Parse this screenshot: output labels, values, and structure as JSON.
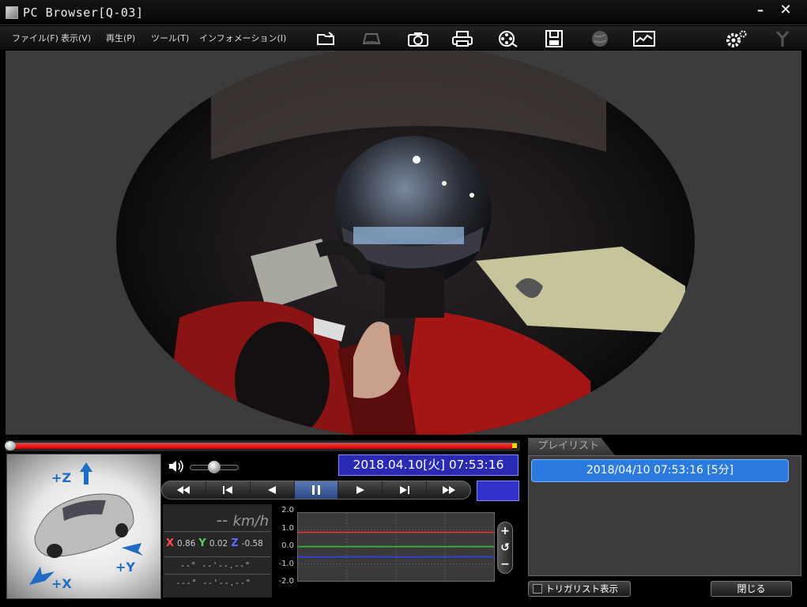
{
  "window": {
    "title": "PC Browser[Q-03]",
    "minimize_label": "–",
    "close_label": "✕"
  },
  "menu": {
    "items": [
      "ファイル(F)",
      "表示(V)",
      "再生(P)",
      "ツール(T)",
      "インフォメーション(I)"
    ]
  },
  "toolbar": {
    "icons": [
      "folder-export-icon",
      "disc-tray-icon",
      "camera-icon",
      "printer-icon",
      "film-search-icon",
      "save-icon",
      "globe-icon",
      "map-chart-icon",
      "settings-gears-icon",
      "antenna-icon"
    ]
  },
  "player": {
    "progress_fraction": 0.99,
    "volume_fraction": 0.5,
    "datetime": "2018.04.10[火] 07:53:16",
    "transport": [
      "rewind",
      "previous",
      "step-back",
      "pause",
      "play",
      "next",
      "fast-forward"
    ],
    "active_transport": "pause"
  },
  "car_view": {
    "axis_z": "+Z",
    "axis_y": "+Y",
    "axis_x": "+X"
  },
  "speed": {
    "value": "-- ",
    "unit": "km/h"
  },
  "gsensor": {
    "x_label": "X",
    "x_value": "0.86",
    "y_label": "Y",
    "y_value": "0.02",
    "z_label": "Z",
    "z_value": "-0.58"
  },
  "coordinates": {
    "lat": "--° --'--.--\"",
    "lon": "---° --'--.--\""
  },
  "graph": {
    "y_ticks": [
      "2.0",
      "1.0",
      "0.0",
      "-1.0",
      "-2.0"
    ],
    "zoom_in": "+",
    "zoom_reset": "↺",
    "zoom_out": "−"
  },
  "chart_data": {
    "type": "line",
    "ylim": [
      -2.0,
      2.0
    ],
    "series": [
      {
        "name": "X",
        "color": "#ff3030",
        "values": [
          0.86,
          0.86,
          0.86,
          0.86,
          0.86,
          0.86,
          0.86,
          0.86,
          0.86,
          0.86
        ]
      },
      {
        "name": "Y",
        "color": "#30c030",
        "values": [
          0.02,
          0.02,
          0.02,
          0.02,
          0.02,
          0.02,
          0.02,
          0.02,
          0.02,
          0.02
        ]
      },
      {
        "name": "Z",
        "color": "#3040ff",
        "values": [
          -0.58,
          -0.59,
          -0.58,
          -0.57,
          -0.58,
          -0.59,
          -0.58,
          -0.58,
          -0.57,
          -0.58
        ]
      }
    ]
  },
  "playlist": {
    "tab_label": "プレイリスト",
    "items": [
      "2018/04/10 07:53:16 [5分]"
    ]
  },
  "buttons": {
    "trigger_list": "トリガリスト表示",
    "close": "閉じる"
  },
  "colors": {
    "accent_blue": "#2a7ae0",
    "datetime_bg": "#2a2ab4",
    "progress_red": "#e00000"
  }
}
